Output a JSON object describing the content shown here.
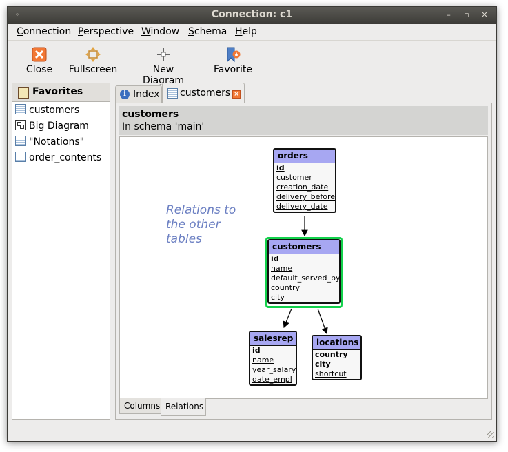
{
  "window": {
    "title": "Connection: c1"
  },
  "menu": {
    "items": [
      {
        "mnemonic": "C",
        "rest": "onnection"
      },
      {
        "mnemonic": "P",
        "rest": "erspective"
      },
      {
        "mnemonic": "W",
        "rest": "indow"
      },
      {
        "mnemonic": "S",
        "rest": "chema"
      },
      {
        "mnemonic": "H",
        "rest": "elp"
      }
    ]
  },
  "toolbar": {
    "close": "Close",
    "fullscreen": "Fullscreen",
    "new_diagram": "New Diagram",
    "favorite": "Favorite"
  },
  "favorites": {
    "title": "Favorites",
    "items": [
      {
        "label": "customers",
        "icon": "table-icon"
      },
      {
        "label": "Big Diagram",
        "icon": "diagram-icon"
      },
      {
        "label": "\"Notations\"",
        "icon": "table-icon"
      },
      {
        "label": "order_contents",
        "icon": "table-icon"
      }
    ]
  },
  "tabs": [
    {
      "label": "Index",
      "icon": "info-icon"
    },
    {
      "label": "customers",
      "icon": "table-icon"
    }
  ],
  "header": {
    "title": "customers",
    "subtitle": "In schema 'main'"
  },
  "diagram": {
    "annotation": [
      "Relations to",
      "the other",
      "tables"
    ],
    "entities": {
      "orders": {
        "name": "orders",
        "rows": [
          "id",
          "customer",
          "creation_date",
          "delivery_before",
          "delivery_date"
        ]
      },
      "customers": {
        "name": "customers",
        "rows": [
          "id",
          "name",
          "default_served_by",
          "country",
          "city"
        ]
      },
      "salesrep": {
        "name": "salesrep",
        "rows": [
          "id",
          "name",
          "year_salary",
          "date_empl"
        ]
      },
      "locations": {
        "name": "locations",
        "rows": [
          "country",
          "city",
          "shortcut"
        ]
      }
    }
  },
  "bottom_tabs": [
    "Columns",
    "Relations"
  ],
  "colors": {
    "entity_header": "#a7a7f2",
    "focus": "#13d14b",
    "annotation": "#6b7fc2",
    "titlebar": "#3c3b37"
  }
}
